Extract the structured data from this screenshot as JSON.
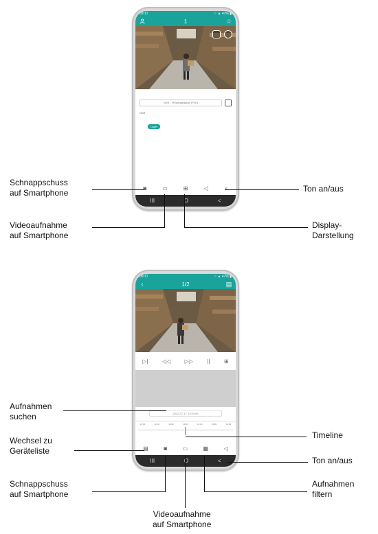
{
  "phone1": {
    "status": {
      "time": "09:17",
      "right": "⁙ ▲ 47% ▮"
    },
    "appbar": {
      "title": "1"
    },
    "device_bar": {
      "text": "NVR - Firmengelände (P2P)"
    },
    "tree": {
      "root": "NVR",
      "child": "Lager"
    },
    "controls": [
      "snapshot-icon",
      "record-icon",
      "grid-icon",
      "speaker-icon",
      "mic-icon"
    ]
  },
  "phone2": {
    "status": {
      "time": "09:17",
      "right": "⁙ ▲ 47% ▮"
    },
    "appbar": {
      "title": "1/2"
    },
    "playback_controls": [
      "frame-icon",
      "rewind-icon",
      "forward-icon",
      "pause-icon",
      "grid-icon"
    ],
    "search_date": "2022-07-17 13:24:05",
    "timeline_ticks": [
      "10:00",
      "11:00",
      "12:00",
      "13:00",
      "14:00",
      "15:00",
      "16:00"
    ],
    "controls": [
      "device-list-icon",
      "snapshot-icon",
      "record-icon",
      "filter-icon",
      "speaker-icon"
    ]
  },
  "navbar": {
    "left": "III",
    "center": "O",
    "right": "<"
  },
  "labels1": {
    "snapshot": "Schnappschuss\nauf Smartphone",
    "sound": "Ton an/aus",
    "video": "Videoaufnahme\nauf Smartphone",
    "display": "Display-\nDarstellung"
  },
  "labels2": {
    "search": "Aufnahmen\nsuchen",
    "switch": "Wechsel zu\nGeräteliste",
    "timeline": "Timeline",
    "sound": "Ton an/aus",
    "snapshot": "Schnappschuss\nauf Smartphone",
    "filter": "Aufnahmen\nfiltern",
    "video": "Videoaufnahme\nauf Smartphone"
  }
}
